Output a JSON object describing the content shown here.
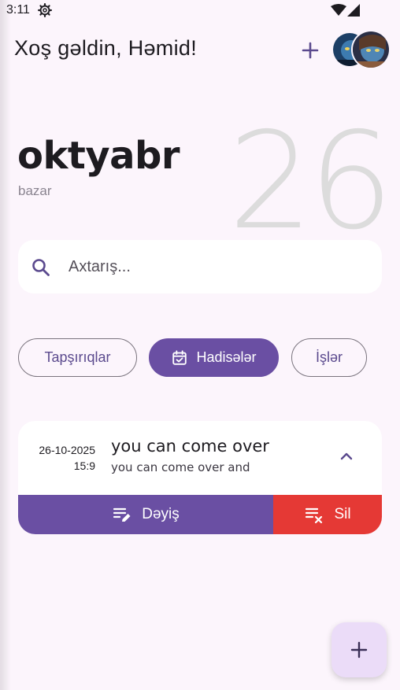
{
  "status_bar": {
    "time": "3:11",
    "icons": [
      "settings-gear-icon",
      "wifi-icon",
      "signal-icon"
    ]
  },
  "header": {
    "greeting": "Xoş gəldin, Həmid!",
    "add_icon": "plus-icon",
    "avatars": [
      "avatar-user-1",
      "avatar-user-2"
    ]
  },
  "date": {
    "day": "26",
    "month": "oktyabr",
    "weekday": "bazar"
  },
  "search": {
    "placeholder": "Axtarış...",
    "value": "",
    "icon": "search-icon"
  },
  "filters": {
    "items": [
      {
        "label": "Tapşırıqlar",
        "selected": false
      },
      {
        "label": "Hadisələr",
        "selected": true,
        "icon": "calendar-check-icon"
      },
      {
        "label": "İşlər",
        "selected": false
      }
    ]
  },
  "events": [
    {
      "date": "26-10-2025",
      "time": "15:9",
      "title": "you can come over",
      "description": "you can come over and",
      "expanded": true,
      "edit_label": "Dəyiş",
      "delete_label": "Sil"
    }
  ],
  "fab": {
    "icon": "plus-icon"
  },
  "colors": {
    "background": "#fcf5fc",
    "primary": "#6a4fa3",
    "danger": "#e53935",
    "fab": "#ebdcf8",
    "big_day": "#dcdcdc"
  }
}
